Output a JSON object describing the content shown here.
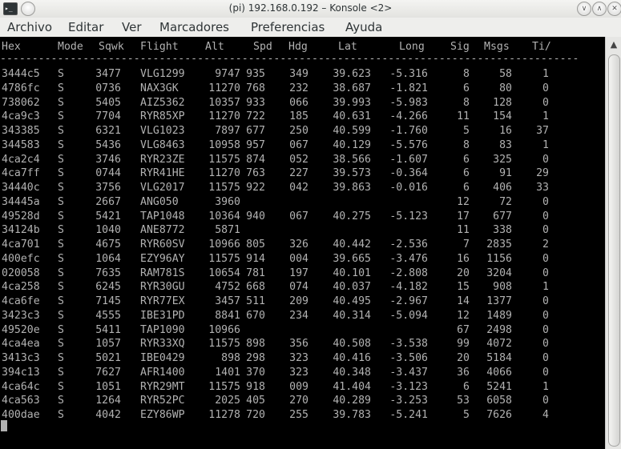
{
  "window": {
    "title": "(pi) 192.168.0.192 – Konsole <2>",
    "app_icon_glyph": "▸_",
    "controls": {
      "minimize": "∨",
      "maximize": "∧",
      "close": "✕"
    }
  },
  "menu": [
    "Archivo",
    "Editar",
    "Ver",
    "Marcadores",
    "Preferencias",
    "Ayuda"
  ],
  "columns": [
    "Hex",
    "Mode",
    "Sqwk",
    "Flight",
    "Alt",
    "Spd",
    "Hdg",
    "Lat",
    "Long",
    "Sig",
    "Msgs",
    "Ti/"
  ],
  "separator": "-------------------------------------------------------------------------------------------",
  "rows": [
    [
      "3444c5",
      "S",
      "3477",
      "VLG1299",
      "9747",
      "935",
      "349",
      "39.623",
      "-5.316",
      "8",
      "58",
      "1"
    ],
    [
      "4786fc",
      "S",
      "0736",
      "NAX3GK",
      "11270",
      "768",
      "232",
      "38.687",
      "-1.821",
      "6",
      "80",
      "0"
    ],
    [
      "738062",
      "S",
      "5405",
      "AIZ5362",
      "10357",
      "933",
      "066",
      "39.993",
      "-5.983",
      "8",
      "128",
      "0"
    ],
    [
      "4ca9c3",
      "S",
      "7704",
      "RYR85XP",
      "11270",
      "722",
      "185",
      "40.631",
      "-4.266",
      "11",
      "154",
      "1"
    ],
    [
      "343385",
      "S",
      "6321",
      "VLG1023",
      "7897",
      "677",
      "250",
      "40.599",
      "-1.760",
      "5",
      "16",
      "37"
    ],
    [
      "344583",
      "S",
      "5436",
      "VLG8463",
      "10958",
      "957",
      "067",
      "40.129",
      "-5.576",
      "8",
      "83",
      "1"
    ],
    [
      "4ca2c4",
      "S",
      "3746",
      "RYR23ZE",
      "11575",
      "874",
      "052",
      "38.566",
      "-1.607",
      "6",
      "325",
      "0"
    ],
    [
      "4ca7ff",
      "S",
      "0744",
      "RYR41HE",
      "11270",
      "763",
      "227",
      "39.573",
      "-0.364",
      "6",
      "91",
      "29"
    ],
    [
      "34440c",
      "S",
      "3756",
      "VLG2017",
      "11575",
      "922",
      "042",
      "39.863",
      "-0.016",
      "6",
      "406",
      "33"
    ],
    [
      "34445a",
      "S",
      "2667",
      "ANG050",
      "3960",
      "",
      "",
      "",
      "",
      "12",
      "72",
      "0"
    ],
    [
      "49528d",
      "S",
      "5421",
      "TAP1048",
      "10364",
      "940",
      "067",
      "40.275",
      "-5.123",
      "17",
      "677",
      "0"
    ],
    [
      "34124b",
      "S",
      "1040",
      "ANE8772",
      "5871",
      "",
      "",
      "",
      "",
      "11",
      "338",
      "0"
    ],
    [
      "4ca701",
      "S",
      "4675",
      "RYR60SV",
      "10966",
      "805",
      "326",
      "40.442",
      "-2.536",
      "7",
      "2835",
      "2"
    ],
    [
      "400efc",
      "S",
      "1064",
      "EZY96AY",
      "11575",
      "914",
      "004",
      "39.665",
      "-3.476",
      "16",
      "1156",
      "0"
    ],
    [
      "020058",
      "S",
      "7635",
      "RAM781S",
      "10654",
      "781",
      "197",
      "40.101",
      "-2.808",
      "20",
      "3204",
      "0"
    ],
    [
      "4ca258",
      "S",
      "6245",
      "RYR30GU",
      "4752",
      "668",
      "074",
      "40.037",
      "-4.182",
      "15",
      "908",
      "1"
    ],
    [
      "4ca6fe",
      "S",
      "7145",
      "RYR77EX",
      "3457",
      "511",
      "209",
      "40.495",
      "-2.967",
      "14",
      "1377",
      "0"
    ],
    [
      "3423c3",
      "S",
      "4555",
      "IBE31PD",
      "8841",
      "670",
      "234",
      "40.314",
      "-5.094",
      "12",
      "1489",
      "0"
    ],
    [
      "49520e",
      "S",
      "5411",
      "TAP1090",
      "10966",
      "",
      "",
      "",
      "",
      "67",
      "2498",
      "0"
    ],
    [
      "4ca4ea",
      "S",
      "1057",
      "RYR33XQ",
      "11575",
      "898",
      "356",
      "40.508",
      "-3.538",
      "99",
      "4072",
      "0"
    ],
    [
      "3413c3",
      "S",
      "5021",
      "IBE0429",
      "898",
      "298",
      "323",
      "40.416",
      "-3.506",
      "20",
      "5184",
      "0"
    ],
    [
      "394c13",
      "S",
      "7627",
      "AFR1400",
      "1401",
      "370",
      "323",
      "40.348",
      "-3.437",
      "36",
      "4066",
      "0"
    ],
    [
      "4ca64c",
      "S",
      "1051",
      "RYR29MT",
      "11575",
      "918",
      "009",
      "41.404",
      "-3.123",
      "6",
      "5241",
      "1"
    ],
    [
      "4ca563",
      "S",
      "1264",
      "RYR52PC",
      "2025",
      "405",
      "270",
      "40.289",
      "-3.253",
      "53",
      "6058",
      "0"
    ],
    [
      "400dae",
      "S",
      "4042",
      "EZY86WP",
      "11278",
      "720",
      "255",
      "39.783",
      "-5.241",
      "5",
      "7626",
      "4"
    ]
  ]
}
